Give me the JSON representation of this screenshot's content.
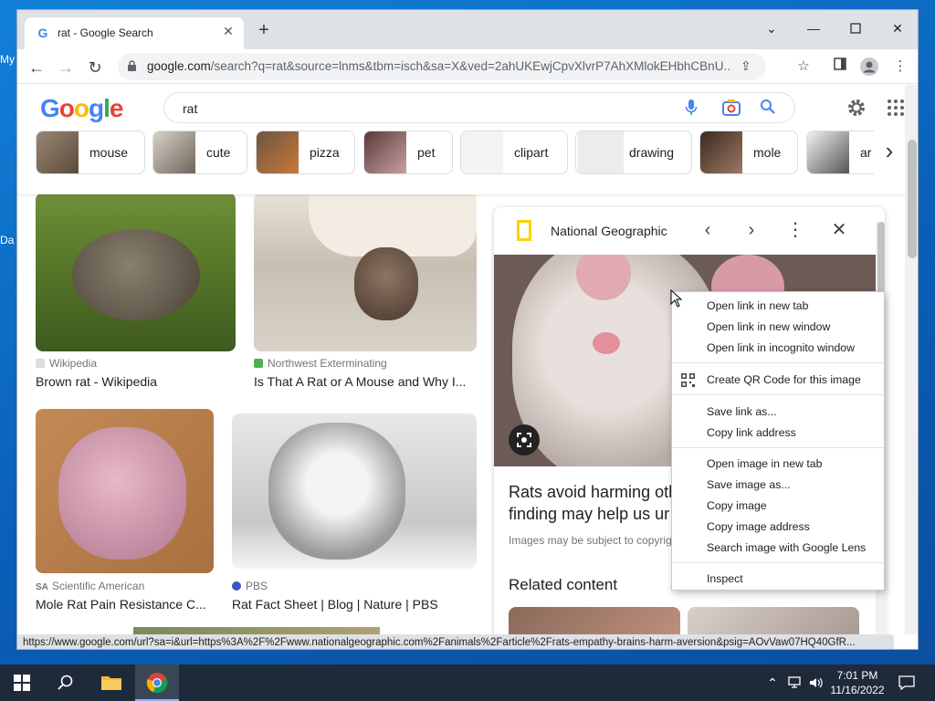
{
  "desktop": {
    "icons": [
      {
        "label": "My"
      },
      {
        "label": "Da"
      }
    ]
  },
  "browser": {
    "tab": {
      "title": "rat - Google Search",
      "favicon": "G"
    },
    "url_host": "google.com",
    "url_path": "/search?q=rat&source=lnms&tbm=isch&sa=X&ved=2ahUKEwjCpvXlvrP7AhXMlokEHbhCBnU...",
    "status_url": "https://www.google.com/url?sa=i&url=https%3A%2F%2Fwww.nationalgeographic.com%2Fanimals%2Farticle%2Frats-empathy-brains-harm-aversion&psig=AOvVaw07HQ40GfR..."
  },
  "google": {
    "logo": "Google",
    "query": "rat",
    "chips": [
      {
        "label": "mouse"
      },
      {
        "label": "cute"
      },
      {
        "label": "pizza"
      },
      {
        "label": "pet"
      },
      {
        "label": "clipart"
      },
      {
        "label": "drawing"
      },
      {
        "label": "mole"
      },
      {
        "label": "ar"
      }
    ],
    "results": [
      {
        "source": "Wikipedia",
        "caption": "Brown rat - Wikipedia"
      },
      {
        "source": "Northwest Exterminating",
        "caption": "Is That A Rat or A Mouse and Why I..."
      },
      {
        "source": "Scientific American",
        "caption": "Mole Rat Pain Resistance C..."
      },
      {
        "source": "PBS",
        "caption": "Rat Fact Sheet | Blog | Nature | PBS"
      }
    ],
    "panel": {
      "source": "National Geographic",
      "title_line1": "Rats avoid harming oth",
      "title_line2": "finding may help us ur",
      "note": "Images may be subject to copyrig",
      "related": "Related content"
    }
  },
  "context_menu": {
    "items": [
      {
        "label": "Open link in new tab"
      },
      {
        "label": "Open link in new window"
      },
      {
        "label": "Open link in incognito window"
      },
      {
        "label": "Create QR Code for this image"
      },
      {
        "label": "Save link as..."
      },
      {
        "label": "Copy link address"
      },
      {
        "label": "Open image in new tab"
      },
      {
        "label": "Save image as..."
      },
      {
        "label": "Copy image"
      },
      {
        "label": "Copy image address"
      },
      {
        "label": "Search image with Google Lens"
      },
      {
        "label": "Inspect"
      }
    ]
  },
  "taskbar": {
    "time": "7:01 PM",
    "date": "11/16/2022"
  }
}
